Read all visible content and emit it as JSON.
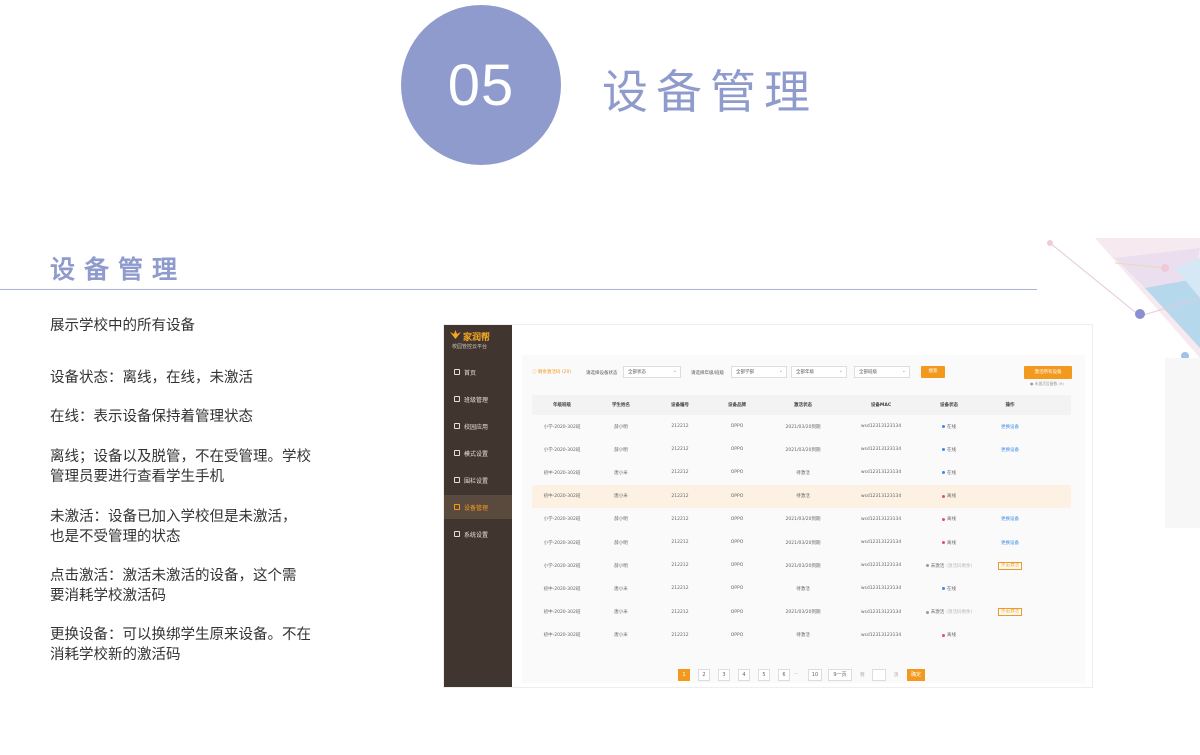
{
  "header": {
    "number": "05",
    "title": "设备管理"
  },
  "section": {
    "title": "设备管理",
    "descriptions": [
      "展示学校中的所有设备",
      "设备状态：离线，在线，未激活",
      "在线：表示设备保持着管理状态",
      "离线；设备以及脱管，不在受管理。学校管理员要进行查看学生手机",
      "未激活：设备已加入学校但是未激活，也是不受管理的状态",
      "点击激活：激活未激活的设备，这个需要消耗学校激活码",
      "更换设备：可以换绑学生原来设备。不在消耗学校新的激活码"
    ]
  },
  "app": {
    "logo": {
      "name": "家润帮",
      "subtitle": "校园管控云平台"
    },
    "menu": [
      "首页",
      "班级管理",
      "校园应用",
      "模式设置",
      "围栏设置",
      "设备管理",
      "系统设置"
    ],
    "active_menu": 5,
    "filters": {
      "note": "ⓘ 剩余激活码 (20)",
      "status_label": "请选择设备状态",
      "status_value": "全部状态",
      "grade_label": "请选择年级/班级",
      "school_value": "全部学部",
      "grade_value": "全部年级",
      "class_value": "全部班级",
      "search_button": "搜索",
      "activate_all_button": "激活所有设备",
      "activate_note": "● 未激活设备数 (9)"
    },
    "table": {
      "columns": [
        "年级班级",
        "学生姓名",
        "设备编号",
        "设备品牌",
        "激活状态",
        "设备MAC",
        "设备状态",
        "操作"
      ],
      "rows": [
        [
          "小学-2020-302班",
          "薛小明",
          "212212",
          "OPPO",
          "2021/03/20到期",
          "wsd12313123134",
          "在线",
          "更换设备"
        ],
        [
          "小学-2020-302班",
          "薛小明",
          "212212",
          "OPPO",
          "2021/03/20到期",
          "wsd12313123134",
          "在线",
          "更换设备"
        ],
        [
          "初中-2020-302班",
          "唐小米",
          "212212",
          "OPPO",
          "待激活",
          "wsd12313123134",
          "在线",
          ""
        ],
        [
          "初中-2020-302班",
          "唐小米",
          "212212",
          "OPPO",
          "待激活",
          "wsd12313123134",
          "离线",
          ""
        ],
        [
          "小学-2020-302班",
          "薛小明",
          "212212",
          "OPPO",
          "2021/03/20到期",
          "wsd12313123134",
          "离线",
          "更换设备"
        ],
        [
          "小学-2020-302班",
          "薛小明",
          "212212",
          "OPPO",
          "2021/03/20到期",
          "wsd12313123134",
          "离线",
          "更换设备"
        ],
        [
          "小学-2020-302班",
          "薛小明",
          "212212",
          "OPPO",
          "2021/03/20到期",
          "wsd12313123134",
          "未激活",
          "点击激活"
        ],
        [
          "初中-2020-302班",
          "唐小米",
          "212212",
          "OPPO",
          "待激活",
          "wsd12313123134",
          "在线",
          ""
        ],
        [
          "初中-2020-302班",
          "唐小米",
          "212212",
          "OPPO",
          "2021/03/20到期",
          "wsd12313123134",
          "未激活",
          "点击激活"
        ],
        [
          "初中-2020-302班",
          "唐小米",
          "212212",
          "OPPO",
          "待激活",
          "wsd12313123134",
          "离线",
          ""
        ]
      ],
      "highlighted_row": 3,
      "status_extra": "(激活码剩余)"
    },
    "pagination": {
      "pages": [
        "1",
        "2",
        "3",
        "4",
        "5",
        "6",
        "10"
      ],
      "ellipsis": "···",
      "per_page": "9一页",
      "goto_label": "到",
      "page_unit": "页",
      "confirm": "确定"
    },
    "colors": {
      "accent": "#f39a1e",
      "sidebar": "#40362f",
      "online": "#3a8ee6",
      "offline": "#e0506e",
      "inactive": "#999999"
    }
  },
  "colors": {
    "header_circle": "#8f9bcc",
    "title": "#8f9bcc"
  }
}
